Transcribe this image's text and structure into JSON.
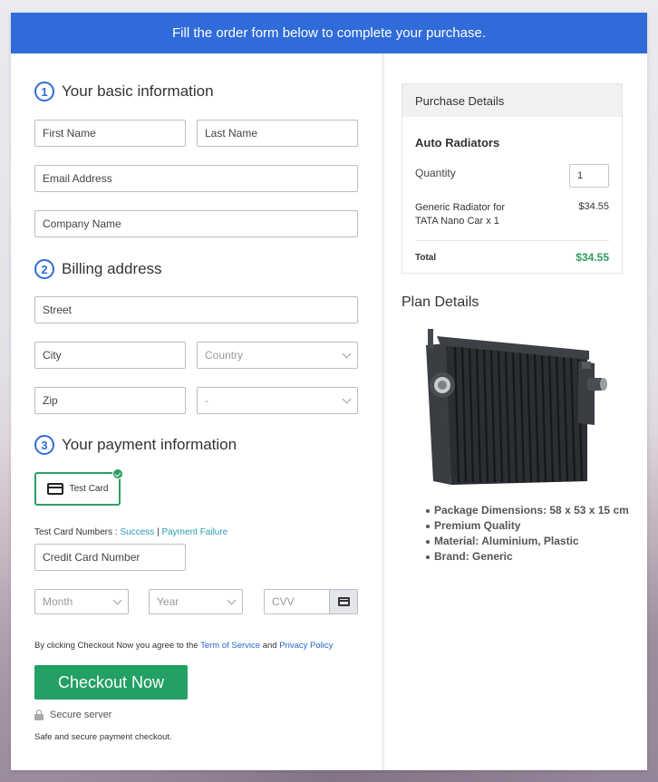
{
  "banner": {
    "text": "Fill the order form below to complete your purchase."
  },
  "sections": {
    "basic": {
      "step": "1",
      "title": "Your basic information"
    },
    "billing": {
      "step": "2",
      "title": "Billing address"
    },
    "payment": {
      "step": "3",
      "title": "Your payment information"
    }
  },
  "fields": {
    "first_name": "First Name",
    "last_name": "Last Name",
    "email": "Email Address",
    "company": "Company Name",
    "street": "Street",
    "city": "City",
    "country": "Country",
    "zip": "Zip",
    "state": "-",
    "card_number": "Credit Card Number",
    "month": "Month",
    "year": "Year",
    "cvv": "CVV"
  },
  "payment": {
    "method_label": "Test Card",
    "test_numbers_label": "Test Card Numbers :",
    "success_link": "Success",
    "separator": "|",
    "failure_link": "Payment Failure"
  },
  "agreement": {
    "prefix": "By clicking Checkout Now you agree to the",
    "terms_link": "Term of Service",
    "and": "and",
    "privacy_link": "Privacy Policy"
  },
  "checkout": {
    "button_label": "Checkout Now",
    "secure_label": "Secure server",
    "safe_text": "Safe and secure payment checkout."
  },
  "purchase": {
    "header": "Purchase Details",
    "product_group": "Auto Radiators",
    "quantity_label": "Quantity",
    "quantity_value": "1",
    "item_line1": "Generic Radiator for",
    "item_line2": "TATA Nano Car x 1",
    "item_price": "$34.55",
    "total_label": "Total",
    "total_value": "$34.55"
  },
  "plan": {
    "title": "Plan Details",
    "features": [
      "Package Dimensions: 58 x 53 x 15 cm",
      "Premium Quality",
      "Material: Aluminium, Plastic",
      "Brand: Generic"
    ]
  },
  "colors": {
    "banner_blue": "#2f6bd9",
    "checkout_green": "#23a064",
    "total_green": "#2e9e5f",
    "link_teal": "#2a9cb2"
  }
}
